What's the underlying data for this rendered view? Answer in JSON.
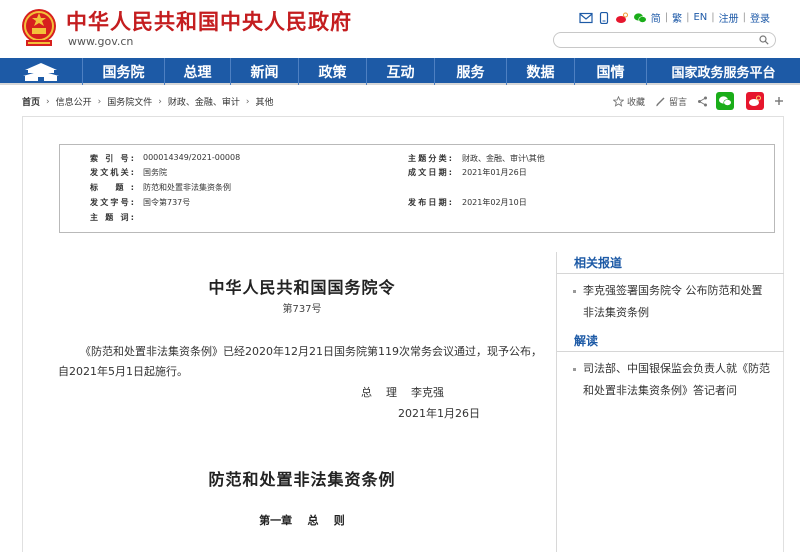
{
  "header": {
    "title": "中华人民共和国中央人民政府",
    "domain": "www.gov.cn",
    "links": [
      "简",
      "繁",
      "EN",
      "注册",
      "登录"
    ],
    "search_placeholder": ""
  },
  "nav": {
    "items": [
      "国务院",
      "总理",
      "新闻",
      "政策",
      "互动",
      "服务",
      "数据",
      "国情",
      "国家政务服务平台"
    ]
  },
  "breadcrumb": {
    "items": [
      "首页",
      "信息公开",
      "国务院文件",
      "财政、金融、审计",
      "其他"
    ]
  },
  "share": {
    "collect": "收藏",
    "comment": "留言"
  },
  "info": {
    "index_no_label": "索 引 号:",
    "index_no": "000014349/2021-00008",
    "category_label": "主题分类:",
    "category": "财政、金融、审计\\其他",
    "issuer_label": "发文机关:",
    "issuer": "国务院",
    "created_label": "成文日期:",
    "created": "2021年01月26日",
    "title_label": "标    题:",
    "title": "防范和处置非法集资条例",
    "doc_no_label": "发文字号:",
    "doc_no": "国令第737号",
    "published_label": "发布日期:",
    "published": "2021年02月10日",
    "keywords_label": "主 题 词:",
    "keywords": ""
  },
  "article": {
    "heading": "中华人民共和国国务院令",
    "order_no": "第737号",
    "paragraph": "《防范和处置非法集资条例》已经2020年12月21日国务院第119次常务会议通过，现予公布，自2021年5月1日起施行。",
    "signer": "总    理    李克强",
    "sign_date": "2021年1月26日",
    "law_title": "防范和处置非法集资条例",
    "chapter": "第一章    总    则"
  },
  "sidebar": {
    "related_title": "相关报道",
    "related": [
      "李克强签署国务院令 公布防范和处置非法集资条例"
    ],
    "interpret_title": "解读",
    "interpret": [
      "司法部、中国银保监会负责人就《防范和处置非法集资条例》答记者问"
    ]
  },
  "colors": {
    "brand_red": "#c41d1f",
    "nav_blue": "#1d5aa6",
    "wechat_green": "#1aad19",
    "weibo_red": "#e6162d"
  }
}
